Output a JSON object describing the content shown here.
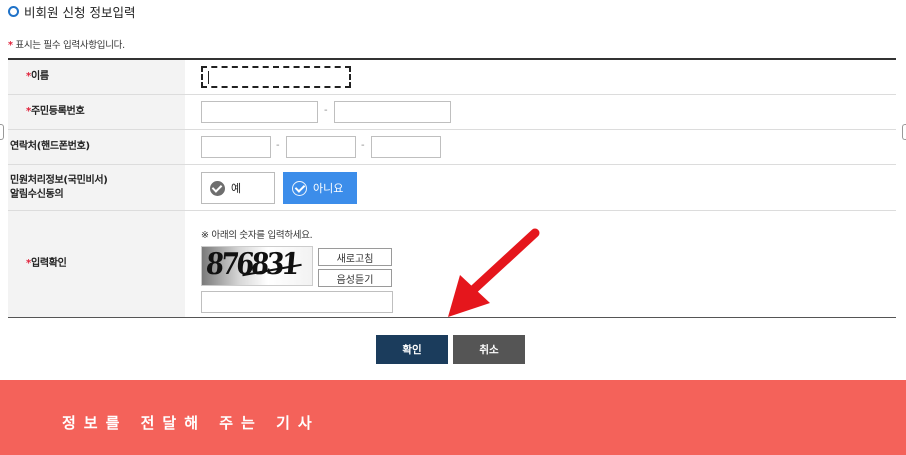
{
  "section_title": "비회원 신청 정보입력",
  "required_note": {
    "star": "*",
    "text": " 표시는 필수 입력사항입니다."
  },
  "rows": {
    "name": {
      "star": "*",
      "label": " 이름"
    },
    "rrn": {
      "star": "*",
      "label": " 주민등록번호",
      "separator": "-"
    },
    "phone": {
      "label": "연락처(핸드폰번호)",
      "separator": "-"
    },
    "consent": {
      "label_line1": "민원처리정보(국민비서)",
      "label_line2": "알림수신동의",
      "yes_label": "예",
      "no_label": "아니요",
      "selected": "아니요"
    },
    "captcha": {
      "star": "*",
      "label": " 입력확인",
      "note": "※ 아래의 숫자를 입력하세요.",
      "image_text": "876831",
      "refresh_label": "새로고침",
      "audio_label": "음성듣기"
    }
  },
  "buttons": {
    "confirm": "확인",
    "cancel": "취소"
  },
  "banner_text": "정보를 전달해 주는 기사",
  "colors": {
    "accent_blue": "#3c8dea",
    "confirm_bg": "#1b3c5c",
    "cancel_bg": "#555555",
    "banner_bg": "#f4625a",
    "arrow": "#e5161c",
    "required_star": "#e0213a"
  }
}
